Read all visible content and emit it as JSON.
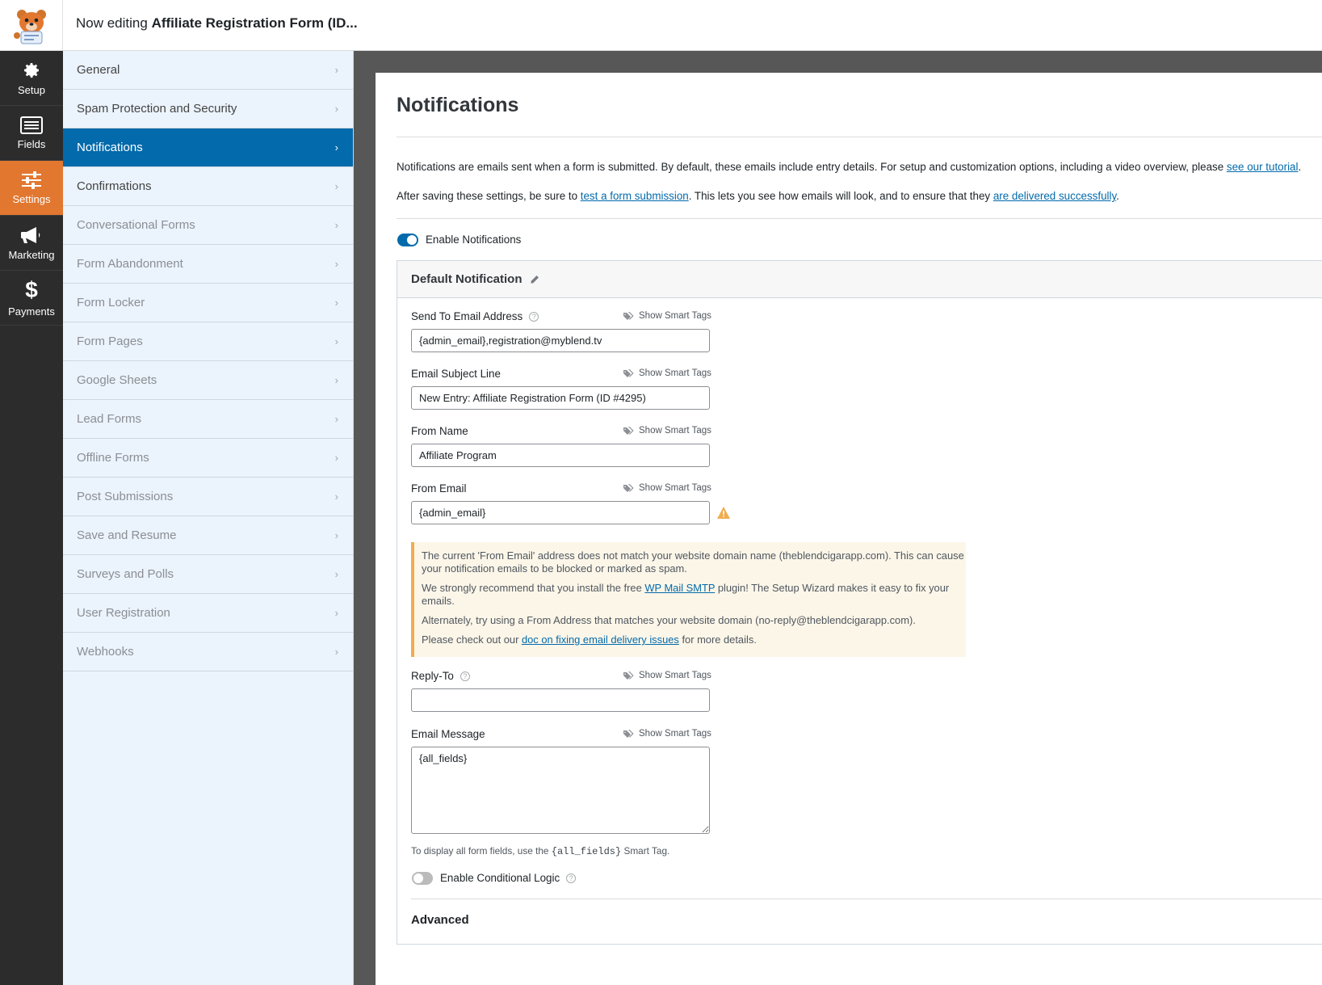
{
  "header": {
    "prefix": "Now editing ",
    "form_name": "Affiliate Registration Form (ID..."
  },
  "rail": [
    {
      "label": "Setup",
      "icon": "gear-icon"
    },
    {
      "label": "Fields",
      "icon": "fields-list-icon"
    },
    {
      "label": "Settings",
      "icon": "sliders-icon"
    },
    {
      "label": "Marketing",
      "icon": "megaphone-icon"
    },
    {
      "label": "Payments",
      "icon": "dollar-icon"
    }
  ],
  "submenu": {
    "items": [
      "General",
      "Spam Protection and Security",
      "Notifications",
      "Confirmations",
      "Conversational Forms",
      "Form Abandonment",
      "Form Locker",
      "Form Pages",
      "Google Sheets",
      "Lead Forms",
      "Offline Forms",
      "Post Submissions",
      "Save and Resume",
      "Surveys and Polls",
      "User Registration",
      "Webhooks"
    ],
    "chevron": "›"
  },
  "main": {
    "title": "Notifications",
    "intro": {
      "text": "Notifications are emails sent when a form is submitted. By default, these emails include entry details. For setup and customization options, including a video overview, please ",
      "link": "see our tutorial",
      "end": "."
    },
    "after": {
      "text1": "After saving these settings, be sure to ",
      "link1": "test a form submission",
      "text2": ". This lets you see how emails will look, and to ensure that they ",
      "link2": "are delivered successfully",
      "end": "."
    },
    "enable_label": "Enable Notifications",
    "notification": {
      "title": "Default Notification",
      "smart_tags": "Show Smart Tags",
      "send_to_label": "Send To Email Address",
      "send_to_value": "{admin_email},registration@myblend.tv",
      "subject_label": "Email Subject Line",
      "subject_value": "New Entry: Affiliate Registration Form (ID #4295)",
      "from_name_label": "From Name",
      "from_name_value": "Affiliate Program",
      "from_email_label": "From Email",
      "from_email_value": "{admin_email}",
      "alert": {
        "p1": "The current 'From Email' address does not match your website domain name (theblendcigarapp.com). This can cause your notification emails to be blocked or marked as spam.",
        "p2_a": "We strongly recommend that you install the free ",
        "p2_link": "WP Mail SMTP",
        "p2_b": " plugin! The Setup Wizard makes it easy to fix your emails.",
        "p3": "Alternately, try using a From Address that matches your website domain (no-reply@theblendcigarapp.com).",
        "p4_a": "Please check out our ",
        "p4_link": "doc on fixing email delivery issues",
        "p4_b": " for more details."
      },
      "reply_to_label": "Reply-To",
      "reply_to_value": "",
      "message_label": "Email Message",
      "message_value": "{all_fields}",
      "hint_a": "To display all form fields, use the ",
      "hint_code": "{all_fields}",
      "hint_b": " Smart Tag.",
      "conditional_label": "Enable Conditional Logic",
      "advanced": "Advanced"
    }
  },
  "colors": {
    "accent": "#036aab",
    "settings_active": "#e27730",
    "rail_bg": "#2c2c2c",
    "submenu_bg": "#ebf3fc",
    "warning": "#f0ad4e"
  }
}
